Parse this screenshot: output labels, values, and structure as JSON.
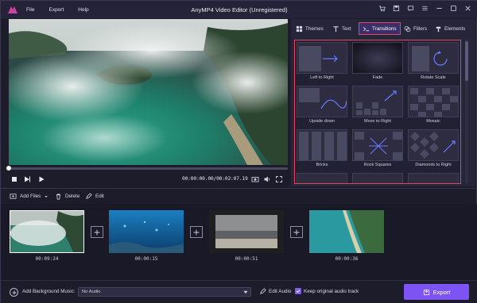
{
  "window": {
    "title": "AnyMP4 Video Editor (Unregistered)",
    "menu": [
      "File",
      "Export",
      "Help"
    ],
    "controls": [
      "cart-icon",
      "save-icon",
      "feedback-icon",
      "menu-icon",
      "minimize-icon",
      "maximize-icon",
      "close-icon"
    ]
  },
  "player": {
    "timecode": "00:00:00.00/00:02:07.19",
    "progress": 0.0
  },
  "panel": {
    "tabs": [
      "Themes",
      "Text",
      "Transitions",
      "Filters",
      "Elements"
    ],
    "active_tab": "Transitions",
    "transitions": [
      "Left to Right",
      "Fade",
      "Rotate Scale",
      "Upside down",
      "Move to Right",
      "Mosaic",
      "Bricks",
      "Rock Squares",
      "Diamonds to Right"
    ]
  },
  "toolbar": {
    "add_files": "Add Files",
    "delete": "Delete",
    "edit": "Edit"
  },
  "timeline": {
    "clips": [
      {
        "duration": "00:09:24"
      },
      {
        "duration": "00:00:15"
      },
      {
        "duration": "00:00:51"
      },
      {
        "duration": "00:00:36"
      }
    ]
  },
  "bottom": {
    "bg_music_label": "Add Background Music:",
    "audio_value": "No Audio",
    "edit_audio": "Edit Audio",
    "keep_audio": "Keep original audio track",
    "keep_audio_checked": true,
    "export": "Export"
  },
  "colors": {
    "accent": "#7d54f3",
    "highlight": "#e2475a"
  }
}
